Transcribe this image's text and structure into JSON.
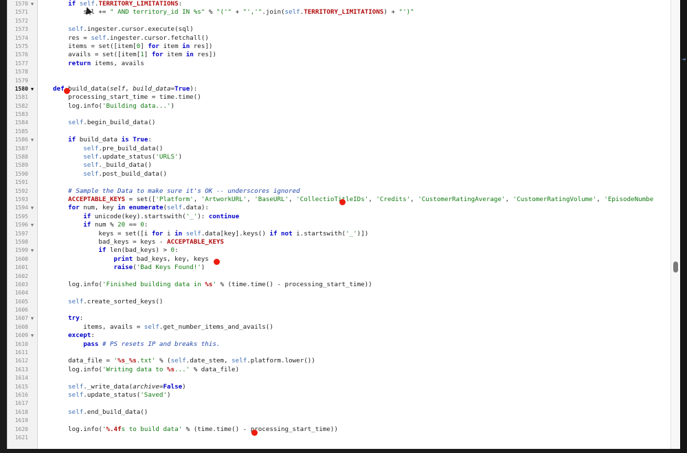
{
  "editor": {
    "lines": [
      {
        "n": "1570",
        "fold": "▼",
        "indent": 2,
        "tokens": [
          [
            "kw",
            "if "
          ],
          [
            "self",
            "self"
          ],
          [
            "plain",
            "."
          ],
          [
            "const",
            "TERRITORY_LIMITATIONS"
          ],
          [
            "plain",
            ":"
          ]
        ]
      },
      {
        "n": "1571",
        "fold": "",
        "indent": 3,
        "tokens": [
          [
            "plain",
            "sql += "
          ],
          [
            "str",
            "\" AND territory_id IN %s\""
          ],
          [
            "plain",
            " % "
          ],
          [
            "str",
            "\"('\""
          ],
          [
            "plain",
            " + "
          ],
          [
            "str",
            "\"','\""
          ],
          [
            "plain",
            ".join("
          ],
          [
            "self",
            "self"
          ],
          [
            "plain",
            "."
          ],
          [
            "const",
            "TERRITORY_LIMITATIONS"
          ],
          [
            "plain",
            ") + "
          ],
          [
            "str",
            "\"')\""
          ]
        ]
      },
      {
        "n": "1572",
        "fold": "",
        "indent": 0,
        "tokens": []
      },
      {
        "n": "1573",
        "fold": "",
        "indent": 2,
        "tokens": [
          [
            "self",
            "self"
          ],
          [
            "plain",
            ".ingester.cursor.execute(sql)"
          ]
        ]
      },
      {
        "n": "1574",
        "fold": "",
        "indent": 2,
        "tokens": [
          [
            "plain",
            "res = "
          ],
          [
            "self",
            "self"
          ],
          [
            "plain",
            ".ingester.cursor.fetchall()"
          ]
        ]
      },
      {
        "n": "1575",
        "fold": "",
        "indent": 2,
        "tokens": [
          [
            "plain",
            "items = set([item["
          ],
          [
            "str",
            "0"
          ],
          [
            "plain",
            "] "
          ],
          [
            "kw",
            "for"
          ],
          [
            "plain",
            " item "
          ],
          [
            "kw",
            "in"
          ],
          [
            "plain",
            " res])"
          ]
        ]
      },
      {
        "n": "1576",
        "fold": "",
        "indent": 2,
        "tokens": [
          [
            "plain",
            "avails = set([item["
          ],
          [
            "str",
            "1"
          ],
          [
            "plain",
            "] "
          ],
          [
            "kw",
            "for"
          ],
          [
            "plain",
            " item "
          ],
          [
            "kw",
            "in"
          ],
          [
            "plain",
            " res])"
          ]
        ]
      },
      {
        "n": "1577",
        "fold": "",
        "indent": 2,
        "tokens": [
          [
            "kw",
            "return"
          ],
          [
            "plain",
            " items, avails"
          ]
        ]
      },
      {
        "n": "1578",
        "fold": "",
        "indent": 0,
        "tokens": []
      },
      {
        "n": "1579",
        "fold": "",
        "indent": 0,
        "tokens": []
      },
      {
        "n": "1580",
        "fold": "▼",
        "indent": 1,
        "current": true,
        "tokens": [
          [
            "kw",
            "def"
          ],
          [
            "plain",
            " "
          ],
          [
            "plain",
            "build_data("
          ],
          [
            "param",
            "self"
          ],
          [
            "plain",
            ", "
          ],
          [
            "param",
            "build_data"
          ],
          [
            "plain",
            "="
          ],
          [
            "kw",
            "True"
          ],
          [
            "plain",
            "):"
          ]
        ]
      },
      {
        "n": "1581",
        "fold": "",
        "indent": 2,
        "tokens": [
          [
            "plain",
            "processing_start_time = time.time()"
          ]
        ]
      },
      {
        "n": "1582",
        "fold": "",
        "indent": 2,
        "tokens": [
          [
            "plain",
            "log.info("
          ],
          [
            "str",
            "'Building data...'"
          ],
          [
            "plain",
            ")"
          ]
        ]
      },
      {
        "n": "1583",
        "fold": "",
        "indent": 0,
        "tokens": []
      },
      {
        "n": "1584",
        "fold": "",
        "indent": 2,
        "tokens": [
          [
            "self",
            "self"
          ],
          [
            "plain",
            ".begin_build_data()"
          ]
        ]
      },
      {
        "n": "1585",
        "fold": "",
        "indent": 0,
        "tokens": []
      },
      {
        "n": "1586",
        "fold": "▼",
        "indent": 2,
        "tokens": [
          [
            "kw",
            "if"
          ],
          [
            "plain",
            " build_data "
          ],
          [
            "kw",
            "is"
          ],
          [
            "plain",
            " "
          ],
          [
            "kw",
            "True"
          ],
          [
            "plain",
            ":"
          ]
        ]
      },
      {
        "n": "1587",
        "fold": "",
        "indent": 3,
        "tokens": [
          [
            "self",
            "self"
          ],
          [
            "plain",
            ".pre_build_data()"
          ]
        ]
      },
      {
        "n": "1588",
        "fold": "",
        "indent": 3,
        "tokens": [
          [
            "self",
            "self"
          ],
          [
            "plain",
            ".update_status("
          ],
          [
            "str",
            "'URLS'"
          ],
          [
            "plain",
            ")"
          ]
        ]
      },
      {
        "n": "1589",
        "fold": "",
        "indent": 3,
        "tokens": [
          [
            "self",
            "self"
          ],
          [
            "plain",
            "._build_data()"
          ]
        ]
      },
      {
        "n": "1590",
        "fold": "",
        "indent": 3,
        "tokens": [
          [
            "self",
            "self"
          ],
          [
            "plain",
            ".post_build_data()"
          ]
        ]
      },
      {
        "n": "1591",
        "fold": "",
        "indent": 0,
        "tokens": []
      },
      {
        "n": "1592",
        "fold": "",
        "indent": 2,
        "tokens": [
          [
            "com",
            "# Sample the Data to make sure it's OK -- underscores ignored"
          ]
        ]
      },
      {
        "n": "1593",
        "fold": "",
        "indent": 2,
        "tokens": [
          [
            "const",
            "ACCEPTABLE_KEYS"
          ],
          [
            "plain",
            " = set(["
          ],
          [
            "str",
            "'Platform'"
          ],
          [
            "plain",
            ", "
          ],
          [
            "str",
            "'ArtworkURL'"
          ],
          [
            "plain",
            ", "
          ],
          [
            "str",
            "'BaseURL'"
          ],
          [
            "plain",
            ", "
          ],
          [
            "str",
            "'Collectio"
          ],
          [
            "str",
            "TitleIDs'"
          ],
          [
            "plain",
            ", "
          ],
          [
            "str",
            "'Credits'"
          ],
          [
            "plain",
            ", "
          ],
          [
            "str",
            "'CustomerRatingAverage'"
          ],
          [
            "plain",
            ", "
          ],
          [
            "str",
            "'CustomerRatingVolume'"
          ],
          [
            "plain",
            ", "
          ],
          [
            "str",
            "'EpisodeNumbe"
          ]
        ]
      },
      {
        "n": "1594",
        "fold": "▼",
        "indent": 2,
        "tokens": [
          [
            "kw",
            "for"
          ],
          [
            "plain",
            " num, key "
          ],
          [
            "kw",
            "in"
          ],
          [
            "plain",
            " "
          ],
          [
            "kw",
            "enumerate"
          ],
          [
            "plain",
            "("
          ],
          [
            "self",
            "self"
          ],
          [
            "plain",
            ".data):"
          ]
        ]
      },
      {
        "n": "1595",
        "fold": "",
        "indent": 3,
        "tokens": [
          [
            "kw",
            "if"
          ],
          [
            "plain",
            " unicode(key).startswith("
          ],
          [
            "str",
            "'_'"
          ],
          [
            "plain",
            "): "
          ],
          [
            "kw",
            "continue"
          ]
        ]
      },
      {
        "n": "1596",
        "fold": "▼",
        "indent": 3,
        "tokens": [
          [
            "kw",
            "if"
          ],
          [
            "plain",
            " num % "
          ],
          [
            "str",
            "20"
          ],
          [
            "plain",
            " == "
          ],
          [
            "str",
            "0"
          ],
          [
            "plain",
            ":"
          ]
        ]
      },
      {
        "n": "1597",
        "fold": "",
        "indent": 4,
        "tokens": [
          [
            "plain",
            "keys = set([i "
          ],
          [
            "kw",
            "for"
          ],
          [
            "plain",
            " i "
          ],
          [
            "kw",
            "in"
          ],
          [
            "plain",
            " "
          ],
          [
            "self",
            "self"
          ],
          [
            "plain",
            ".data[key].keys() "
          ],
          [
            "kw",
            "if not"
          ],
          [
            "plain",
            " i.startswith("
          ],
          [
            "str",
            "'_'"
          ],
          [
            "plain",
            ")])"
          ]
        ]
      },
      {
        "n": "1598",
        "fold": "",
        "indent": 4,
        "tokens": [
          [
            "plain",
            "bad_keys = keys - "
          ],
          [
            "const",
            "ACCEPTABLE_KEYS"
          ]
        ]
      },
      {
        "n": "1599",
        "fold": "▼",
        "indent": 4,
        "tokens": [
          [
            "kw",
            "if"
          ],
          [
            "plain",
            " len(bad_keys) > "
          ],
          [
            "str",
            "0"
          ],
          [
            "plain",
            ":"
          ]
        ]
      },
      {
        "n": "1600",
        "fold": "",
        "indent": 5,
        "tokens": [
          [
            "kw",
            "print"
          ],
          [
            "plain",
            " bad_keys, key, keys"
          ]
        ]
      },
      {
        "n": "1601",
        "fold": "",
        "indent": 5,
        "tokens": [
          [
            "kw",
            "raise"
          ],
          [
            "plain",
            "("
          ],
          [
            "str",
            "'Bad Keys Found!'"
          ],
          [
            "plain",
            ")"
          ]
        ]
      },
      {
        "n": "1602",
        "fold": "",
        "indent": 0,
        "tokens": []
      },
      {
        "n": "1603",
        "fold": "",
        "indent": 2,
        "tokens": [
          [
            "plain",
            "log.info("
          ],
          [
            "str",
            "'Finished building data in "
          ],
          [
            "const",
            "%s"
          ],
          [
            "str",
            "'"
          ],
          [
            "plain",
            " % (time.time() - processing_start_time))"
          ]
        ]
      },
      {
        "n": "1604",
        "fold": "",
        "indent": 0,
        "tokens": []
      },
      {
        "n": "1605",
        "fold": "",
        "indent": 2,
        "tokens": [
          [
            "self",
            "self"
          ],
          [
            "plain",
            ".create_sorted_keys()"
          ]
        ]
      },
      {
        "n": "1606",
        "fold": "",
        "indent": 0,
        "tokens": []
      },
      {
        "n": "1607",
        "fold": "▼",
        "indent": 2,
        "tokens": [
          [
            "kw",
            "try"
          ],
          [
            "plain",
            ":"
          ]
        ]
      },
      {
        "n": "1608",
        "fold": "",
        "indent": 3,
        "tokens": [
          [
            "plain",
            "items, avails = "
          ],
          [
            "self",
            "self"
          ],
          [
            "plain",
            ".get_number_items_and_avails()"
          ]
        ]
      },
      {
        "n": "1609",
        "fold": "▼",
        "indent": 2,
        "tokens": [
          [
            "kw",
            "except"
          ],
          [
            "plain",
            ":"
          ]
        ]
      },
      {
        "n": "1610",
        "fold": "",
        "indent": 3,
        "tokens": [
          [
            "kw",
            "pass"
          ],
          [
            "plain",
            " "
          ],
          [
            "com",
            "# PS resets IP and breaks this."
          ]
        ]
      },
      {
        "n": "1611",
        "fold": "",
        "indent": 0,
        "tokens": []
      },
      {
        "n": "1612",
        "fold": "",
        "indent": 2,
        "tokens": [
          [
            "plain",
            "data_file = "
          ],
          [
            "str",
            "'"
          ],
          [
            "const",
            "%s"
          ],
          [
            "str",
            "_"
          ],
          [
            "const",
            "%s"
          ],
          [
            "str",
            ".txt'"
          ],
          [
            "plain",
            " % ("
          ],
          [
            "self",
            "self"
          ],
          [
            "plain",
            ".date_stem, "
          ],
          [
            "self",
            "self"
          ],
          [
            "plain",
            ".platform.lower())"
          ]
        ]
      },
      {
        "n": "1613",
        "fold": "",
        "indent": 2,
        "tokens": [
          [
            "plain",
            "log.info("
          ],
          [
            "str",
            "'Writing data to "
          ],
          [
            "const",
            "%s"
          ],
          [
            "str",
            "...'"
          ],
          [
            "plain",
            " % data_file)"
          ]
        ]
      },
      {
        "n": "1614",
        "fold": "",
        "indent": 0,
        "tokens": []
      },
      {
        "n": "1615",
        "fold": "",
        "indent": 2,
        "tokens": [
          [
            "self",
            "self"
          ],
          [
            "plain",
            "._write_data("
          ],
          [
            "param",
            "archive"
          ],
          [
            "plain",
            "="
          ],
          [
            "kw",
            "False"
          ],
          [
            "plain",
            ")"
          ]
        ]
      },
      {
        "n": "1616",
        "fold": "",
        "indent": 2,
        "tokens": [
          [
            "self",
            "self"
          ],
          [
            "plain",
            ".update_status("
          ],
          [
            "str",
            "'Saved'"
          ],
          [
            "plain",
            ")"
          ]
        ]
      },
      {
        "n": "1617",
        "fold": "",
        "indent": 0,
        "tokens": []
      },
      {
        "n": "1618",
        "fold": "",
        "indent": 2,
        "tokens": [
          [
            "self",
            "self"
          ],
          [
            "plain",
            ".end_build_data()"
          ]
        ]
      },
      {
        "n": "1619",
        "fold": "",
        "indent": 0,
        "tokens": []
      },
      {
        "n": "1620",
        "fold": "",
        "indent": 2,
        "tokens": [
          [
            "plain",
            "log.info("
          ],
          [
            "str",
            "'"
          ],
          [
            "const",
            "%.4f"
          ],
          [
            "str",
            "s to build data'"
          ],
          [
            "plain",
            " % (time.time() - processing_start_time))"
          ]
        ]
      },
      {
        "n": "1621",
        "fold": "",
        "indent": 0,
        "tokens": []
      }
    ]
  },
  "colors": {
    "keyword": "#0000c8",
    "self": "#3e6fb5",
    "string": "#127a12",
    "constant": "#b00b0b",
    "comment": "#2046ad",
    "breakpoint": "#ec1c0f"
  }
}
